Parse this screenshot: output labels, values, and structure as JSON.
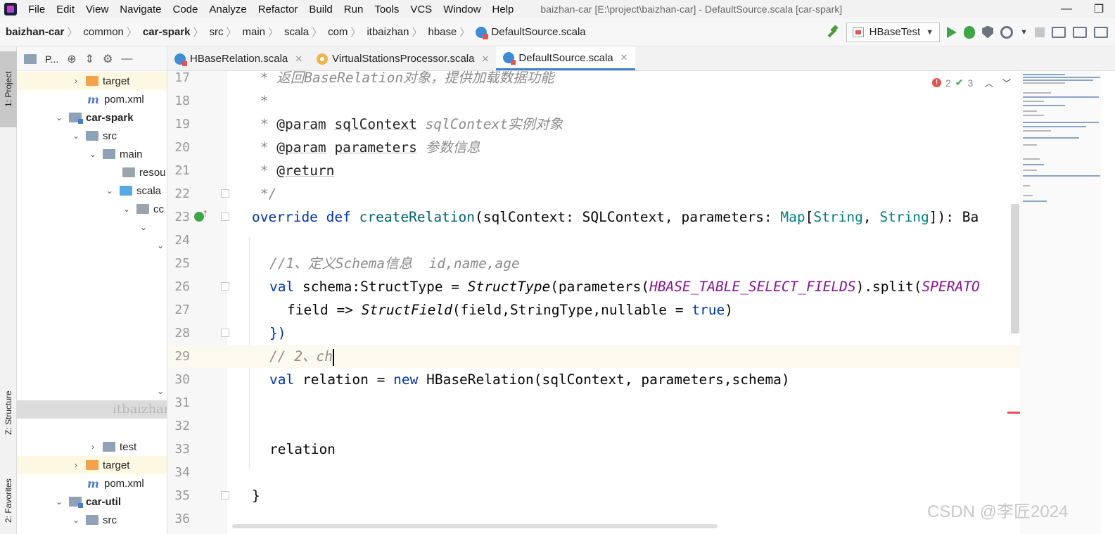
{
  "menubar": {
    "items": [
      "File",
      "Edit",
      "View",
      "Navigate",
      "Code",
      "Analyze",
      "Refactor",
      "Build",
      "Run",
      "Tools",
      "VCS",
      "Window",
      "Help"
    ],
    "window_title": "baizhan-car [E:\\project\\baizhan-car] - DefaultSource.scala [car-spark]",
    "controls": {
      "minimize": "—",
      "maximize": "❐"
    }
  },
  "navbar": {
    "crumbs": [
      "baizhan-car",
      "common",
      "car-spark",
      "src",
      "main",
      "scala",
      "com",
      "itbaizhan",
      "hbase"
    ],
    "file": "DefaultSource.scala",
    "run_config": "HBaseTest"
  },
  "stripe": {
    "project": "1: Project",
    "structure": "Z: Structure",
    "favorites": "2: Favorites"
  },
  "project_panel": {
    "header": "P...",
    "tree": [
      {
        "label": "target",
        "icon": "folder-orange-icon",
        "bold": false
      },
      {
        "label": "pom.xml",
        "icon": "maven-icon",
        "bold": false
      },
      {
        "label": "car-spark",
        "icon": "module-folder-icon",
        "bold": true
      },
      {
        "label": "src",
        "icon": "folder-icon",
        "bold": false
      },
      {
        "label": "main",
        "icon": "folder-icon",
        "bold": false
      },
      {
        "label": "resou",
        "icon": "resources-folder-icon",
        "bold": false
      },
      {
        "label": "scala",
        "icon": "folder-blue-icon",
        "bold": false
      },
      {
        "label": "cc",
        "icon": "package-icon",
        "bold": false
      },
      {
        "label": "test",
        "icon": "folder-icon",
        "bold": false
      },
      {
        "label": "target",
        "icon": "folder-orange-icon",
        "bold": false
      },
      {
        "label": "pom.xml",
        "icon": "maven-icon",
        "bold": false
      },
      {
        "label": "car-util",
        "icon": "module-folder-icon",
        "bold": true
      },
      {
        "label": "src",
        "icon": "folder-icon",
        "bold": false
      }
    ],
    "structure_overlay_text": "itbaizhan"
  },
  "tabs": [
    {
      "label": "HBaseRelation.scala",
      "icon": "scala-class-icon",
      "active": false
    },
    {
      "label": "VirtualStationsProcessor.scala",
      "icon": "scala-object-icon",
      "active": false
    },
    {
      "label": "DefaultSource.scala",
      "icon": "scala-class-icon",
      "active": true
    }
  ],
  "editor": {
    "line_numbers": [
      "17",
      "18",
      "19",
      "20",
      "21",
      "22",
      "23",
      "24",
      "25",
      "26",
      "27",
      "28",
      "29",
      "30",
      "31",
      "32",
      "33",
      "34",
      "35",
      "36"
    ],
    "lines": {
      "l17": {
        "doc": " * 返回BaseRelation对象，提供加载数据功能"
      },
      "l18": {
        "doc": " *"
      },
      "l19": {
        "star": " * ",
        "tag": "@param",
        "sp": " ",
        "name": "sqlContext",
        "desc": " sqlContext实例对象"
      },
      "l20": {
        "star": " * ",
        "tag": "@param",
        "sp": " ",
        "name": "parameters",
        "desc": " 参数信息"
      },
      "l21": {
        "star": " * ",
        "tag": "@return"
      },
      "l22": {
        "doc": " */"
      },
      "l23": {
        "kw1": "override",
        "sp1": " ",
        "kw2": "def",
        "sp2": " ",
        "fn": "createRelation",
        "a": "(sqlContext: SQLContext, parameters: ",
        "t1": "Map",
        "b": "[",
        "t2": "String",
        "c": ", ",
        "t3": "String",
        "d": "]): Ba"
      },
      "l25": {
        "cmt": "//1、定义Schema信息  id,name,age"
      },
      "l26": {
        "kw": "val",
        "a": " schema:StructType = ",
        "it": "StructType",
        "b": "(parameters(",
        "cst": "HBASE_TABLE_SELECT_FIELDS",
        "c": ").split(",
        "cst2": "SPERATO"
      },
      "l27": {
        "a": "field => ",
        "it": "StructField",
        "b": "(field,StringType,nullable = ",
        "kw": "true",
        "c": ")"
      },
      "l28": {
        "a": "})"
      },
      "l29": {
        "cmt": "// 2、ch"
      },
      "l30": {
        "kw": "val",
        "a": " relation = ",
        "kw2": "new",
        "b": " HBaseRelation(sqlContext, parameters,schema)"
      },
      "l33": {
        "a": "relation"
      },
      "l35": {
        "a": "}"
      }
    },
    "inspections": {
      "errors": "2",
      "warnings": "3"
    }
  },
  "watermark": "CSDN @李匠2024",
  "colors": {
    "accent": "#4083c9",
    "keyword": "#0033b3",
    "function": "#00627a",
    "type": "#008080",
    "constant": "#871094",
    "comment": "#8c8c8c"
  }
}
